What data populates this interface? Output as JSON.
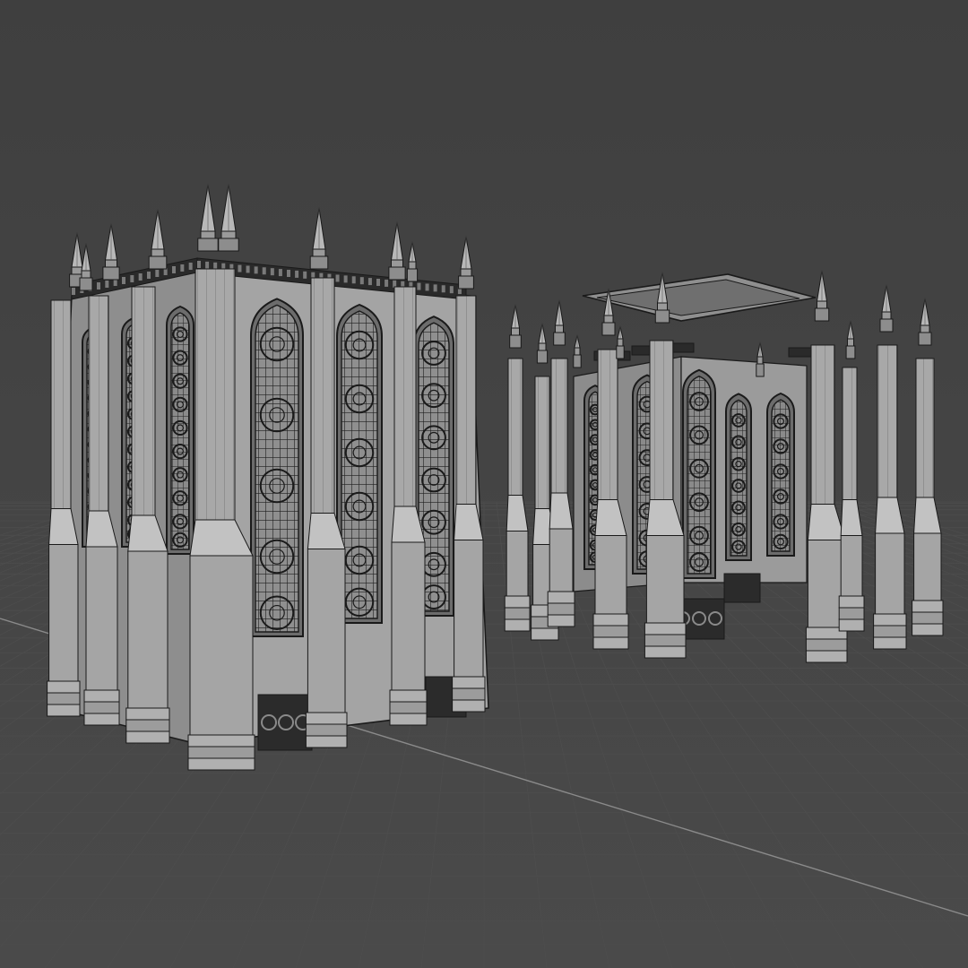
{
  "viewport": {
    "mode": "wireframe-on-shaded",
    "background_color": "#414141",
    "grid_color": "#4d4d4d",
    "axis_color": "#8a8a8a",
    "model_color": "#a9a9a9",
    "wire_color": "#1a1a1a"
  },
  "models": [
    {
      "kind": "gothic-tower-assembled",
      "spires": 10
    },
    {
      "kind": "gothic-tower-exploded",
      "spires": 12,
      "roof_panel": true
    }
  ]
}
